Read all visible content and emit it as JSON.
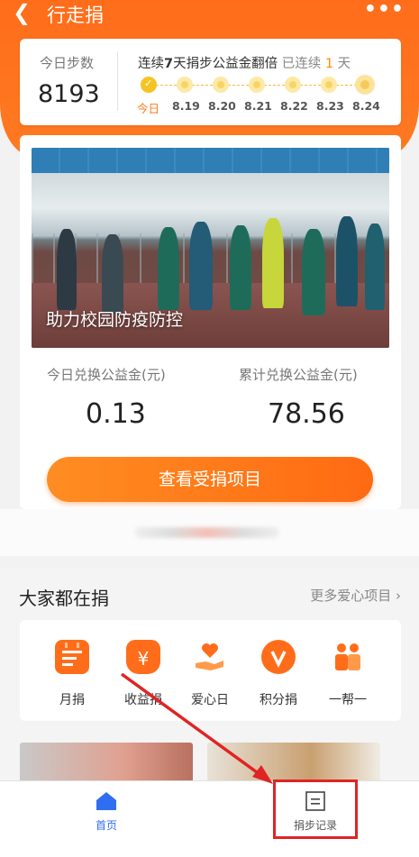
{
  "header": {
    "back_icon": "chevron-left-icon",
    "title": "行走捐",
    "more_icon": "more-icon"
  },
  "steps": {
    "label": "今日步数",
    "value": "8193",
    "streak_prefix": "连续",
    "streak_days": "7",
    "streak_suffix": "天捐步公益金翻倍",
    "streak_status_prefix": "已连续",
    "streak_status_count": "1",
    "streak_status_suffix": "天",
    "days": [
      "今日",
      "8.19",
      "8.20",
      "8.21",
      "8.22",
      "8.23",
      "8.24"
    ]
  },
  "project": {
    "caption": "助力校园防疫防控",
    "today_label": "今日兑换公益金(元)",
    "today_value": "0.13",
    "total_label": "累计兑换公益金(元)",
    "total_value": "78.56",
    "cta_label": "查看受捐项目"
  },
  "section": {
    "title": "大家都在捐",
    "more_label": "更多爱心项目",
    "categories": [
      {
        "label": "月捐",
        "icon": "calendar-icon",
        "color": "#ff6d1a"
      },
      {
        "label": "收益捐",
        "icon": "money-bag-icon",
        "color": "#ff6d1a"
      },
      {
        "label": "爱心日",
        "icon": "heart-hand-icon",
        "color": "#ff6d1a"
      },
      {
        "label": "积分捐",
        "icon": "points-icon",
        "color": "#ff6d1a"
      },
      {
        "label": "一帮一",
        "icon": "people-icon",
        "color": "#ff6d1a"
      }
    ]
  },
  "nav": {
    "home_label": "首页",
    "home_icon": "home-icon",
    "records_label": "捐步记录",
    "records_icon": "document-icon"
  },
  "colors": {
    "accent": "#ff6d1a",
    "nav_active": "#2f6ef0",
    "highlight": "#e02424"
  }
}
